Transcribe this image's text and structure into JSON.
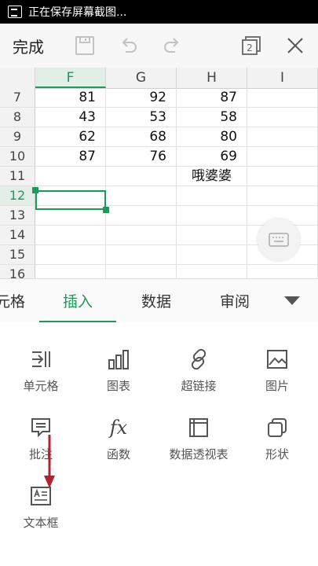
{
  "status_bar": {
    "text": "正在保存屏幕截图..."
  },
  "toolbar": {
    "done_label": "完成",
    "window_count": "2"
  },
  "grid": {
    "columns": [
      "F",
      "G",
      "H",
      "I"
    ],
    "rows": [
      {
        "num": "7",
        "cells": [
          "81",
          "92",
          "87",
          ""
        ]
      },
      {
        "num": "8",
        "cells": [
          "43",
          "53",
          "58",
          ""
        ]
      },
      {
        "num": "9",
        "cells": [
          "62",
          "68",
          "80",
          ""
        ]
      },
      {
        "num": "10",
        "cells": [
          "87",
          "76",
          "69",
          ""
        ]
      },
      {
        "num": "11",
        "cells": [
          "",
          "",
          "哦婆婆",
          ""
        ]
      },
      {
        "num": "12",
        "cells": [
          "",
          "",
          "",
          ""
        ]
      },
      {
        "num": "13",
        "cells": [
          "",
          "",
          "",
          ""
        ]
      },
      {
        "num": "14",
        "cells": [
          "",
          "",
          "",
          ""
        ]
      },
      {
        "num": "15",
        "cells": [
          "",
          "",
          "",
          ""
        ]
      },
      {
        "num": "16",
        "cells": [
          "",
          "",
          "",
          ""
        ]
      }
    ]
  },
  "tabs": [
    {
      "label": "元格"
    },
    {
      "label": "插入"
    },
    {
      "label": "数据"
    },
    {
      "label": "审阅"
    }
  ],
  "insert_items": [
    {
      "label": "单元格",
      "icon": "cell-icon"
    },
    {
      "label": "图表",
      "icon": "chart-icon"
    },
    {
      "label": "超链接",
      "icon": "link-icon"
    },
    {
      "label": "图片",
      "icon": "picture-icon"
    },
    {
      "label": "批注",
      "icon": "comment-icon"
    },
    {
      "label": "函数",
      "icon": "function-icon",
      "glyph": "fx"
    },
    {
      "label": "数据透视表",
      "icon": "pivot-table-icon"
    },
    {
      "label": "形状",
      "icon": "shape-icon"
    },
    {
      "label": "文本框",
      "icon": "textbox-icon"
    }
  ],
  "colors": {
    "accent": "#1a9b5a",
    "arrow": "#b3232f"
  }
}
